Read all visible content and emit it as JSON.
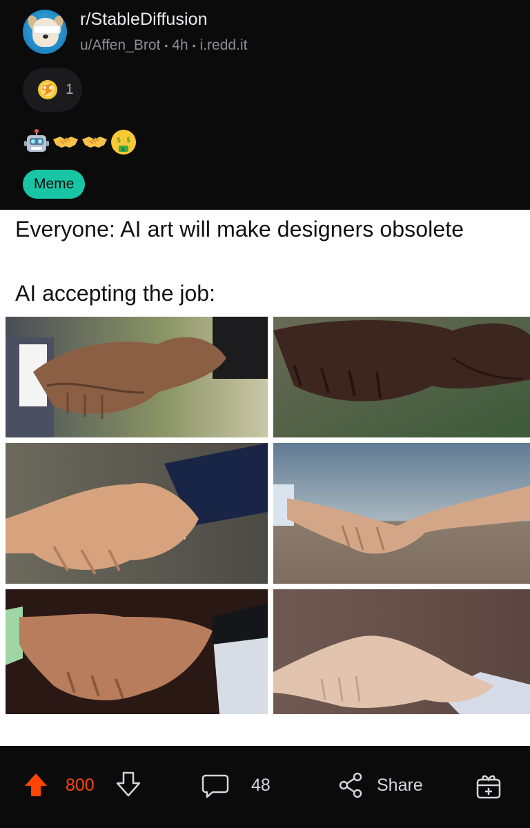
{
  "post": {
    "subreddit": "r/StableDiffusion",
    "author": "u/Affen_Brot",
    "age": "4h",
    "domain": "i.redd.it",
    "award_count": "1",
    "title_emojis": [
      "robot-emoji",
      "handshake-emoji",
      "handshake-emoji",
      "money-mouth-emoji"
    ],
    "flair": "Meme"
  },
  "meme": {
    "line1": "Everyone: AI art will make designers obsolete",
    "line2": "AI accepting the job:"
  },
  "actions": {
    "score": "800",
    "comments": "48",
    "share_label": "Share"
  },
  "colors": {
    "background": "#0b0b0c",
    "upvote": "#ff4500",
    "flair": "#18c6a6",
    "muted": "#8c8c91"
  }
}
